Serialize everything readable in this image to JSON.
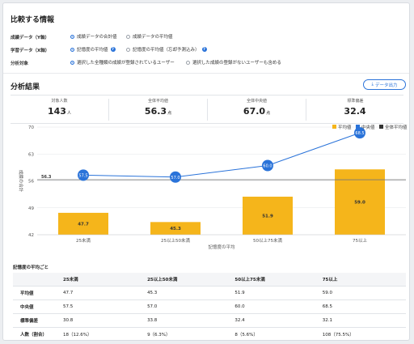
{
  "compare": {
    "title": "比較する情報",
    "rows": [
      {
        "label": "成績データ（Y軸）",
        "options": [
          {
            "text": "成績データの合計値",
            "selected": true
          },
          {
            "text": "成績データの平均値",
            "selected": false
          }
        ]
      },
      {
        "label": "学習データ（X軸）",
        "options": [
          {
            "text": "記憶度の平均値",
            "selected": true
          },
          {
            "text": "記憶度の平均値（忘却予測込み）",
            "selected": false
          }
        ]
      },
      {
        "label": "分析対象",
        "options": [
          {
            "text": "選択した全種類の成績が登録されているユーザー",
            "selected": true
          },
          {
            "text": "選択した成績の登録がないユーザーも含める",
            "selected": false
          }
        ]
      }
    ]
  },
  "results": {
    "title": "分析結果",
    "export_label": "データ出力",
    "stats": [
      {
        "label": "対象人数",
        "value": "143",
        "unit": "人"
      },
      {
        "label": "全体平均値",
        "value": "56.3",
        "unit": "点"
      },
      {
        "label": "全体中央値",
        "value": "67.0",
        "unit": "点"
      },
      {
        "label": "標準偏差",
        "value": "32.4",
        "unit": ""
      }
    ]
  },
  "chart_data": {
    "type": "bar",
    "categories": [
      "25未満",
      "25以上50未満",
      "50以上75未満",
      "75以上"
    ],
    "series": [
      {
        "name": "平均値",
        "type": "bar",
        "values": [
          47.7,
          45.3,
          51.9,
          59.0
        ],
        "color": "#f5b51b"
      },
      {
        "name": "中央値",
        "type": "line",
        "values": [
          57.5,
          57.0,
          60.0,
          68.5
        ],
        "color": "#2a73d9"
      }
    ],
    "reference_line": {
      "name": "全体平均値",
      "value": 56.3,
      "label": "56.3",
      "color": "#333333"
    },
    "xlabel": "記憶度の平均",
    "ylabel": "成績の合計",
    "ylim": [
      42,
      70
    ],
    "yticks": [
      42,
      49,
      56,
      63,
      70
    ],
    "legend_position": "top-right",
    "grid": "horizontal"
  },
  "table": {
    "caption": "記憶度の平均ごと",
    "headers": [
      "",
      "25未満",
      "25以上50未満",
      "50以上75未満",
      "75以上"
    ],
    "rows": [
      [
        "平均値",
        "47.7",
        "45.3",
        "51.9",
        "59.0"
      ],
      [
        "中央値",
        "57.5",
        "57.0",
        "60.0",
        "68.5"
      ],
      [
        "標準偏差",
        "30.8",
        "33.8",
        "32.4",
        "32.1"
      ],
      [
        "人数（割合）",
        "18（12.6%）",
        "9（6.3%）",
        "8（5.6%）",
        "108（75.5%）"
      ]
    ]
  }
}
